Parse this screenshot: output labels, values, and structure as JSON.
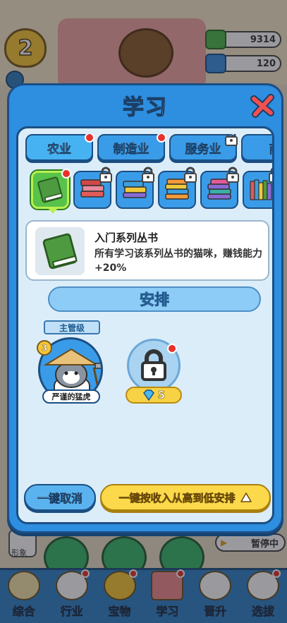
{
  "background": {
    "level": "2",
    "resources": [
      "9314",
      "120"
    ],
    "side_label": "形象",
    "pause_label": "暂停中"
  },
  "nav": [
    {
      "label": "综合",
      "icon": "paw-icon"
    },
    {
      "label": "行业",
      "icon": "cat-icon"
    },
    {
      "label": "宝物",
      "icon": "treasure-icon"
    },
    {
      "label": "学习",
      "icon": "book-icon"
    },
    {
      "label": "晋升",
      "icon": "promote-icon"
    },
    {
      "label": "选拔",
      "icon": "cat-recruit-icon"
    }
  ],
  "modal": {
    "title": "学习",
    "tabs": [
      {
        "label": "农业",
        "badge": true,
        "locked": false,
        "active": true
      },
      {
        "label": "制造业",
        "badge": true,
        "locked": false,
        "active": false
      },
      {
        "label": "服务业",
        "badge": false,
        "locked": true,
        "active": false
      },
      {
        "label": "商",
        "badge": false,
        "locked": false,
        "active": false
      }
    ],
    "books": [
      {
        "name": "green-book",
        "color": "#5aa84a",
        "locked": false,
        "badge": true
      },
      {
        "name": "red-books",
        "color": "#e25a5a",
        "locked": true,
        "badge": false
      },
      {
        "name": "yellow-books",
        "color": "#f0c93a",
        "locked": true,
        "badge": false
      },
      {
        "name": "orange-books",
        "color": "#f39a3a",
        "locked": true,
        "badge": false
      },
      {
        "name": "purple-books",
        "color": "#8a6ad6",
        "locked": true,
        "badge": false
      },
      {
        "name": "rainbow-books",
        "color": "#3aa0e0",
        "locked": true,
        "badge": false
      }
    ],
    "info": {
      "title": "入门系列丛书",
      "desc": "所有学习该系列丛书的猫咪，赚钱能力+20%"
    },
    "arrange_label": "安排",
    "manager": {
      "role": "主管级",
      "level": "3",
      "name": "严谨的猛虎"
    },
    "locked_cost": "5",
    "cancel_label": "一键取消",
    "auto_label": "一键按收入从高到低安排"
  }
}
